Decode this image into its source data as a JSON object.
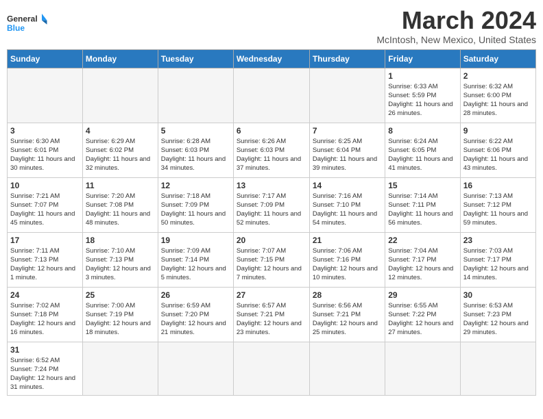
{
  "logo": {
    "text_general": "General",
    "text_blue": "Blue"
  },
  "title": "March 2024",
  "subtitle": "McIntosh, New Mexico, United States",
  "weekdays": [
    "Sunday",
    "Monday",
    "Tuesday",
    "Wednesday",
    "Thursday",
    "Friday",
    "Saturday"
  ],
  "weeks": [
    [
      {
        "day": "",
        "empty": true
      },
      {
        "day": "",
        "empty": true
      },
      {
        "day": "",
        "empty": true
      },
      {
        "day": "",
        "empty": true
      },
      {
        "day": "",
        "empty": true
      },
      {
        "day": "1",
        "info": "Sunrise: 6:33 AM\nSunset: 5:59 PM\nDaylight: 11 hours and 26 minutes."
      },
      {
        "day": "2",
        "info": "Sunrise: 6:32 AM\nSunset: 6:00 PM\nDaylight: 11 hours and 28 minutes."
      }
    ],
    [
      {
        "day": "3",
        "info": "Sunrise: 6:30 AM\nSunset: 6:01 PM\nDaylight: 11 hours and 30 minutes."
      },
      {
        "day": "4",
        "info": "Sunrise: 6:29 AM\nSunset: 6:02 PM\nDaylight: 11 hours and 32 minutes."
      },
      {
        "day": "5",
        "info": "Sunrise: 6:28 AM\nSunset: 6:03 PM\nDaylight: 11 hours and 34 minutes."
      },
      {
        "day": "6",
        "info": "Sunrise: 6:26 AM\nSunset: 6:03 PM\nDaylight: 11 hours and 37 minutes."
      },
      {
        "day": "7",
        "info": "Sunrise: 6:25 AM\nSunset: 6:04 PM\nDaylight: 11 hours and 39 minutes."
      },
      {
        "day": "8",
        "info": "Sunrise: 6:24 AM\nSunset: 6:05 PM\nDaylight: 11 hours and 41 minutes."
      },
      {
        "day": "9",
        "info": "Sunrise: 6:22 AM\nSunset: 6:06 PM\nDaylight: 11 hours and 43 minutes."
      }
    ],
    [
      {
        "day": "10",
        "info": "Sunrise: 7:21 AM\nSunset: 7:07 PM\nDaylight: 11 hours and 45 minutes."
      },
      {
        "day": "11",
        "info": "Sunrise: 7:20 AM\nSunset: 7:08 PM\nDaylight: 11 hours and 48 minutes."
      },
      {
        "day": "12",
        "info": "Sunrise: 7:18 AM\nSunset: 7:09 PM\nDaylight: 11 hours and 50 minutes."
      },
      {
        "day": "13",
        "info": "Sunrise: 7:17 AM\nSunset: 7:09 PM\nDaylight: 11 hours and 52 minutes."
      },
      {
        "day": "14",
        "info": "Sunrise: 7:16 AM\nSunset: 7:10 PM\nDaylight: 11 hours and 54 minutes."
      },
      {
        "day": "15",
        "info": "Sunrise: 7:14 AM\nSunset: 7:11 PM\nDaylight: 11 hours and 56 minutes."
      },
      {
        "day": "16",
        "info": "Sunrise: 7:13 AM\nSunset: 7:12 PM\nDaylight: 11 hours and 59 minutes."
      }
    ],
    [
      {
        "day": "17",
        "info": "Sunrise: 7:11 AM\nSunset: 7:13 PM\nDaylight: 12 hours and 1 minute."
      },
      {
        "day": "18",
        "info": "Sunrise: 7:10 AM\nSunset: 7:13 PM\nDaylight: 12 hours and 3 minutes."
      },
      {
        "day": "19",
        "info": "Sunrise: 7:09 AM\nSunset: 7:14 PM\nDaylight: 12 hours and 5 minutes."
      },
      {
        "day": "20",
        "info": "Sunrise: 7:07 AM\nSunset: 7:15 PM\nDaylight: 12 hours and 7 minutes."
      },
      {
        "day": "21",
        "info": "Sunrise: 7:06 AM\nSunset: 7:16 PM\nDaylight: 12 hours and 10 minutes."
      },
      {
        "day": "22",
        "info": "Sunrise: 7:04 AM\nSunset: 7:17 PM\nDaylight: 12 hours and 12 minutes."
      },
      {
        "day": "23",
        "info": "Sunrise: 7:03 AM\nSunset: 7:17 PM\nDaylight: 12 hours and 14 minutes."
      }
    ],
    [
      {
        "day": "24",
        "info": "Sunrise: 7:02 AM\nSunset: 7:18 PM\nDaylight: 12 hours and 16 minutes."
      },
      {
        "day": "25",
        "info": "Sunrise: 7:00 AM\nSunset: 7:19 PM\nDaylight: 12 hours and 18 minutes."
      },
      {
        "day": "26",
        "info": "Sunrise: 6:59 AM\nSunset: 7:20 PM\nDaylight: 12 hours and 21 minutes."
      },
      {
        "day": "27",
        "info": "Sunrise: 6:57 AM\nSunset: 7:21 PM\nDaylight: 12 hours and 23 minutes."
      },
      {
        "day": "28",
        "info": "Sunrise: 6:56 AM\nSunset: 7:21 PM\nDaylight: 12 hours and 25 minutes."
      },
      {
        "day": "29",
        "info": "Sunrise: 6:55 AM\nSunset: 7:22 PM\nDaylight: 12 hours and 27 minutes."
      },
      {
        "day": "30",
        "info": "Sunrise: 6:53 AM\nSunset: 7:23 PM\nDaylight: 12 hours and 29 minutes."
      }
    ],
    [
      {
        "day": "31",
        "info": "Sunrise: 6:52 AM\nSunset: 7:24 PM\nDaylight: 12 hours and 31 minutes.",
        "last": true
      },
      {
        "day": "",
        "empty": true,
        "last": true
      },
      {
        "day": "",
        "empty": true,
        "last": true
      },
      {
        "day": "",
        "empty": true,
        "last": true
      },
      {
        "day": "",
        "empty": true,
        "last": true
      },
      {
        "day": "",
        "empty": true,
        "last": true
      },
      {
        "day": "",
        "empty": true,
        "last": true
      }
    ]
  ]
}
